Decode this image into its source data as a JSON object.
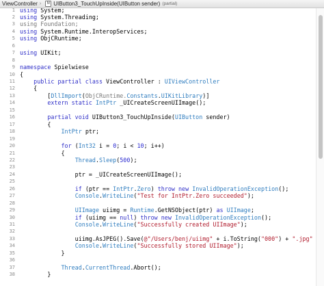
{
  "breadcrumb": {
    "items": [
      "ViewController",
      "UIButton3_TouchUpInside(UIButton sender)"
    ],
    "separator": "›",
    "method_icon": "M",
    "partial": "(partial)"
  },
  "editor": {
    "lines": [
      {
        "n": "1",
        "t": [
          [
            "kw",
            "using"
          ],
          [
            "plain",
            " System;"
          ]
        ]
      },
      {
        "n": "2",
        "t": [
          [
            "kw",
            "using"
          ],
          [
            "plain",
            " System.Threading;"
          ]
        ]
      },
      {
        "n": "3",
        "t": [
          [
            "dim",
            "using Foundation;"
          ]
        ]
      },
      {
        "n": "4",
        "t": [
          [
            "kw",
            "using"
          ],
          [
            "plain",
            " System.Runtime.InteropServices;"
          ]
        ]
      },
      {
        "n": "5",
        "t": [
          [
            "kw",
            "using"
          ],
          [
            "plain",
            " ObjCRuntime;"
          ]
        ]
      },
      {
        "n": "6",
        "t": []
      },
      {
        "n": "7",
        "t": [
          [
            "kw",
            "using"
          ],
          [
            "plain",
            " UIKit;"
          ]
        ]
      },
      {
        "n": "8",
        "t": []
      },
      {
        "n": "9",
        "t": [
          [
            "kw",
            "namespace"
          ],
          [
            "plain",
            " Spielwiese"
          ]
        ]
      },
      {
        "n": "10",
        "t": [
          [
            "plain",
            "{"
          ]
        ]
      },
      {
        "n": "11",
        "t": [
          [
            "plain",
            "    "
          ],
          [
            "kw",
            "public partial class"
          ],
          [
            "plain",
            " ViewController : "
          ],
          [
            "ty",
            "UIViewController"
          ]
        ]
      },
      {
        "n": "12",
        "t": [
          [
            "plain",
            "    {"
          ]
        ]
      },
      {
        "n": "13",
        "t": [
          [
            "plain",
            "        ["
          ],
          [
            "ty",
            "DllImport"
          ],
          [
            "plain",
            "("
          ],
          [
            "dim",
            "ObjCRuntime."
          ],
          [
            "ty",
            "Constants"
          ],
          [
            "plain",
            "."
          ],
          [
            "ty",
            "UIKitLibrary"
          ],
          [
            "plain",
            ")]"
          ]
        ]
      },
      {
        "n": "14",
        "t": [
          [
            "plain",
            "        "
          ],
          [
            "kw",
            "extern static"
          ],
          [
            "plain",
            " "
          ],
          [
            "ty",
            "IntPtr"
          ],
          [
            "plain",
            " _UICreateScreenUIImage();"
          ]
        ]
      },
      {
        "n": "15",
        "t": []
      },
      {
        "n": "16",
        "t": [
          [
            "plain",
            "        "
          ],
          [
            "kw",
            "partial void"
          ],
          [
            "plain",
            " UIButton3_TouchUpInside("
          ],
          [
            "ty",
            "UIButton"
          ],
          [
            "plain",
            " sender)"
          ]
        ]
      },
      {
        "n": "17",
        "t": [
          [
            "plain",
            "        {"
          ]
        ]
      },
      {
        "n": "18",
        "t": [
          [
            "plain",
            "            "
          ],
          [
            "ty",
            "IntPtr"
          ],
          [
            "plain",
            " ptr;"
          ]
        ]
      },
      {
        "n": "19",
        "t": []
      },
      {
        "n": "20",
        "t": [
          [
            "plain",
            "            "
          ],
          [
            "kw",
            "for"
          ],
          [
            "plain",
            " ("
          ],
          [
            "ty",
            "Int32"
          ],
          [
            "plain",
            " i = "
          ],
          [
            "num",
            "0"
          ],
          [
            "plain",
            "; i < "
          ],
          [
            "num",
            "10"
          ],
          [
            "plain",
            "; i++)"
          ]
        ]
      },
      {
        "n": "21",
        "t": [
          [
            "plain",
            "            {"
          ]
        ]
      },
      {
        "n": "22",
        "t": [
          [
            "plain",
            "                "
          ],
          [
            "ty",
            "Thread"
          ],
          [
            "plain",
            "."
          ],
          [
            "ty",
            "Sleep"
          ],
          [
            "plain",
            "("
          ],
          [
            "num",
            "500"
          ],
          [
            "plain",
            ");"
          ]
        ]
      },
      {
        "n": "23",
        "t": []
      },
      {
        "n": "24",
        "t": [
          [
            "plain",
            "                ptr = _UICreateScreenUIImage();"
          ]
        ]
      },
      {
        "n": "25",
        "t": []
      },
      {
        "n": "26",
        "t": [
          [
            "plain",
            "                "
          ],
          [
            "kw",
            "if"
          ],
          [
            "plain",
            " (ptr == "
          ],
          [
            "ty",
            "IntPtr"
          ],
          [
            "plain",
            "."
          ],
          [
            "ty",
            "Zero"
          ],
          [
            "plain",
            ") "
          ],
          [
            "kw",
            "throw new"
          ],
          [
            "plain",
            " "
          ],
          [
            "ty",
            "InvalidOperationException"
          ],
          [
            "plain",
            "();"
          ]
        ]
      },
      {
        "n": "27",
        "t": [
          [
            "plain",
            "                "
          ],
          [
            "ty",
            "Console"
          ],
          [
            "plain",
            "."
          ],
          [
            "ty",
            "WriteLine"
          ],
          [
            "plain",
            "("
          ],
          [
            "str",
            "\"Test for IntPtr.Zero succeeded\""
          ],
          [
            "plain",
            ");"
          ]
        ]
      },
      {
        "n": "28",
        "t": []
      },
      {
        "n": "29",
        "t": [
          [
            "plain",
            "                "
          ],
          [
            "ty",
            "UIImage"
          ],
          [
            "plain",
            " uiimg = "
          ],
          [
            "ty",
            "Runtime"
          ],
          [
            "plain",
            ".GetNSObject(ptr) "
          ],
          [
            "kw",
            "as"
          ],
          [
            "plain",
            " "
          ],
          [
            "ty",
            "UIImage"
          ],
          [
            "plain",
            ";"
          ]
        ]
      },
      {
        "n": "30",
        "t": [
          [
            "plain",
            "                "
          ],
          [
            "kw",
            "if"
          ],
          [
            "plain",
            " (uiimg == "
          ],
          [
            "kw",
            "null"
          ],
          [
            "plain",
            ") "
          ],
          [
            "kw",
            "throw new"
          ],
          [
            "plain",
            " "
          ],
          [
            "ty",
            "InvalidOperationException"
          ],
          [
            "plain",
            "();"
          ]
        ]
      },
      {
        "n": "31",
        "t": [
          [
            "plain",
            "                "
          ],
          [
            "ty",
            "Console"
          ],
          [
            "plain",
            "."
          ],
          [
            "ty",
            "WriteLine"
          ],
          [
            "plain",
            "("
          ],
          [
            "str",
            "\"Successfully created UIImage\""
          ],
          [
            "plain",
            ");"
          ]
        ]
      },
      {
        "n": "32",
        "t": []
      },
      {
        "n": "33",
        "t": [
          [
            "plain",
            "                uiimg.AsJPEG().Save("
          ],
          [
            "str",
            "@\"/Users/benj/uiimg\""
          ],
          [
            "plain",
            " + i.ToString("
          ],
          [
            "str",
            "\"000\""
          ],
          [
            "plain",
            ") + "
          ],
          [
            "str",
            "\".jpg\""
          ]
        ]
      },
      {
        "n": "34",
        "t": [
          [
            "plain",
            "                "
          ],
          [
            "ty",
            "Console"
          ],
          [
            "plain",
            "."
          ],
          [
            "ty",
            "WriteLine"
          ],
          [
            "plain",
            "("
          ],
          [
            "str",
            "\"Successfully stored UIImage\""
          ],
          [
            "plain",
            ");"
          ]
        ]
      },
      {
        "n": "35",
        "t": [
          [
            "plain",
            "            }"
          ]
        ]
      },
      {
        "n": "36",
        "t": []
      },
      {
        "n": "37",
        "t": [
          [
            "plain",
            "            "
          ],
          [
            "ty",
            "Thread"
          ],
          [
            "plain",
            "."
          ],
          [
            "ty",
            "CurrentThread"
          ],
          [
            "plain",
            ".Abort();"
          ]
        ]
      },
      {
        "n": "38",
        "t": [
          [
            "plain",
            "        }"
          ]
        ]
      }
    ]
  }
}
